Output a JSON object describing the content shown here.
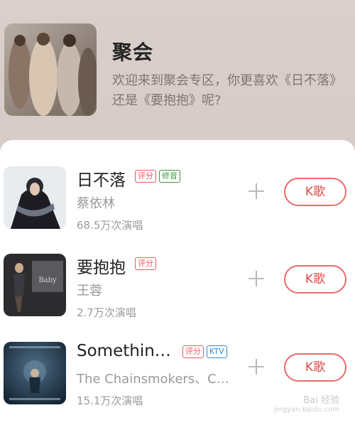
{
  "playlist": {
    "title": "聚会",
    "description": "欢迎来到聚会专区，你更喜欢《日不落》还是《要抱抱》呢?"
  },
  "songs": [
    {
      "title": "日不落",
      "tags": [
        "评分",
        "修音"
      ],
      "artist": "蔡依林",
      "plays": "68.5万次演唱",
      "k_label": "K歌"
    },
    {
      "title": "要抱抱",
      "tags": [
        "评分"
      ],
      "artist": "王蓉",
      "plays": "2.7万次演唱",
      "k_label": "K歌"
    },
    {
      "title": "Somethin…",
      "tags": [
        "评分",
        "KTV"
      ],
      "artist": "The Chainsmokers、C…",
      "plays": "15.1万次演唱",
      "k_label": "K歌"
    }
  ],
  "watermark": {
    "text": "Bai 经验",
    "sub": "jingyan.baidu.com"
  },
  "colors": {
    "accent": "#e04848",
    "sheet": "#ffffff",
    "header_bg": "#d9cfcb"
  }
}
